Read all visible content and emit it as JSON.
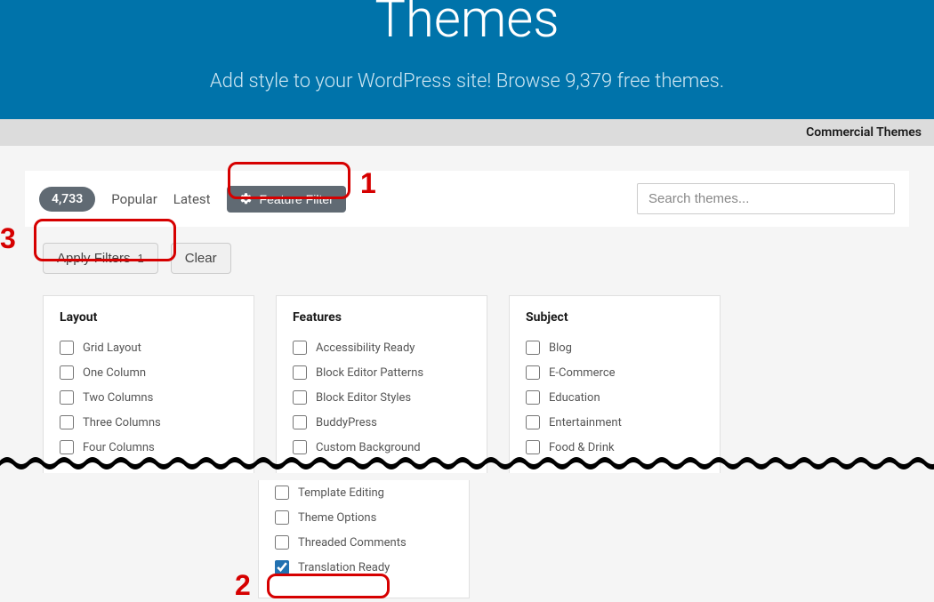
{
  "hero": {
    "title": "Themes",
    "subtitle": "Add style to your WordPress site! Browse 9,379 free themes."
  },
  "commercial_link": "Commercial Themes",
  "toolbar": {
    "count": "4,733",
    "popular": "Popular",
    "latest": "Latest",
    "feature_filter": "Feature Filter",
    "search_placeholder": "Search themes..."
  },
  "actions": {
    "apply_label": "Apply Filters",
    "apply_count": "1",
    "clear": "Clear"
  },
  "annotations": {
    "one": "1",
    "two": "2",
    "three": "3"
  },
  "filters": {
    "layout": {
      "title": "Layout",
      "items": [
        "Grid Layout",
        "One Column",
        "Two Columns",
        "Three Columns",
        "Four Columns"
      ]
    },
    "features": {
      "title": "Features",
      "items": [
        "Accessibility Ready",
        "Block Editor Patterns",
        "Block Editor Styles",
        "BuddyPress",
        "Custom Background"
      ]
    },
    "subject": {
      "title": "Subject",
      "items": [
        "Blog",
        "E-Commerce",
        "Education",
        "Entertainment",
        "Food & Drink"
      ]
    },
    "features_lower": {
      "items": [
        "Template Editing",
        "Theme Options",
        "Threaded Comments",
        "Translation Ready"
      ],
      "checked_index": 3
    }
  }
}
